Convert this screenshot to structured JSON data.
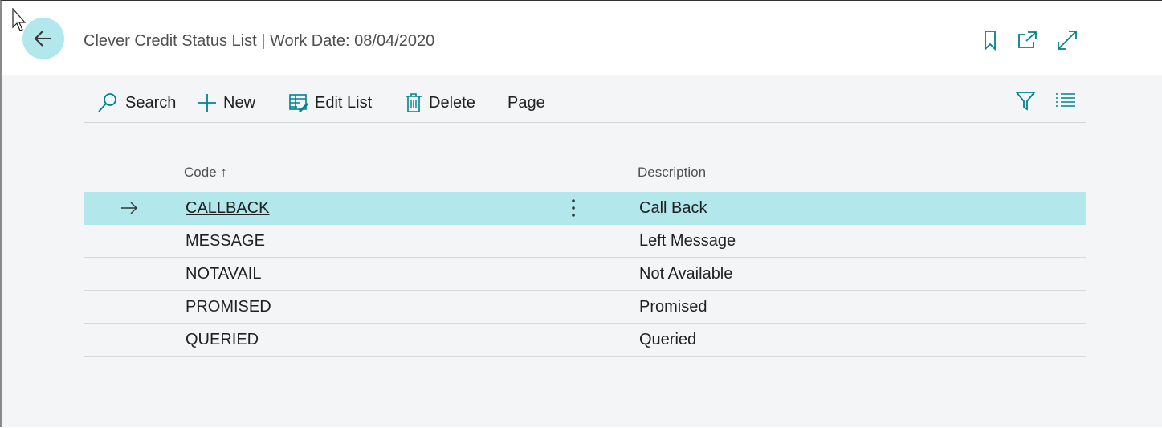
{
  "header": {
    "title": "Clever Credit Status List | Work Date: 08/04/2020"
  },
  "toolbar": {
    "search_label": "Search",
    "new_label": "New",
    "edit_list_label": "Edit List",
    "delete_label": "Delete",
    "page_label": "Page"
  },
  "columns": {
    "code": "Code",
    "code_sort": "↑",
    "description": "Description"
  },
  "rows": [
    {
      "code": "CALLBACK",
      "description": "Call Back",
      "selected": true
    },
    {
      "code": "MESSAGE",
      "description": "Left Message"
    },
    {
      "code": "NOTAVAIL",
      "description": "Not Available"
    },
    {
      "code": "PROMISED",
      "description": "Promised"
    },
    {
      "code": "QUERIED",
      "description": "Queried"
    }
  ],
  "colors": {
    "accent": "#00838f",
    "selection": "#b2e7ec"
  },
  "icons": [
    "back-arrow-icon",
    "bookmark-icon",
    "open-new-window-icon",
    "expand-icon",
    "search-icon",
    "plus-icon",
    "edit-list-icon",
    "trash-icon",
    "filter-icon",
    "list-view-icon",
    "row-arrow-icon",
    "more-options-icon"
  ]
}
